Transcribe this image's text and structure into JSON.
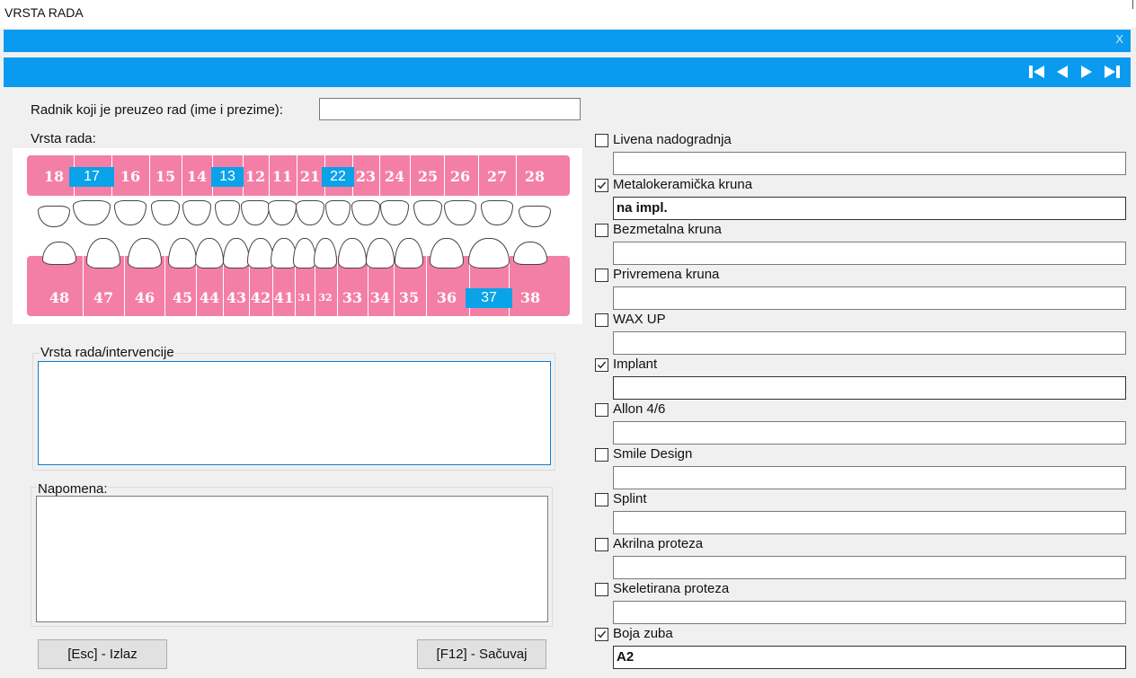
{
  "window": {
    "title": "VRSTA RADA",
    "close_label": "X"
  },
  "nav": [
    {
      "name": "first-record-icon"
    },
    {
      "name": "previous-record-icon"
    },
    {
      "name": "next-record-icon"
    },
    {
      "name": "last-record-icon"
    }
  ],
  "worker": {
    "label": "Radnik koji je preuzeo rad (ime i prezime):",
    "value": ""
  },
  "chart": {
    "label": "Vrsta rada:",
    "upper": [
      "18",
      "17",
      "16",
      "15",
      "14",
      "13",
      "12",
      "11",
      "21",
      "22",
      "23",
      "24",
      "25",
      "26",
      "27",
      "28"
    ],
    "lower": [
      "48",
      "47",
      "46",
      "45",
      "44",
      "43",
      "42",
      "41",
      "31",
      "32",
      "33",
      "34",
      "35",
      "36",
      "37",
      "38"
    ],
    "selected": [
      "17",
      "13",
      "22",
      "37"
    ],
    "band_color": "#f47fa6",
    "selected_color": "#0aa2e8"
  },
  "intervention": {
    "label": "Vrsta rada/intervencije",
    "value": ""
  },
  "note": {
    "label": "Napomena:",
    "value": ""
  },
  "buttons": {
    "exit": "[Esc] - Izlaz",
    "save": "[F12] - Sačuvaj"
  },
  "options": [
    {
      "label": "Livena nadogradnja",
      "checked": false,
      "value": ""
    },
    {
      "label": "Metalokeramička kruna",
      "checked": true,
      "value": "na impl."
    },
    {
      "label": "Bezmetalna kruna",
      "checked": false,
      "value": ""
    },
    {
      "label": "Privremena kruna",
      "checked": false,
      "value": ""
    },
    {
      "label": "WAX UP",
      "checked": false,
      "value": ""
    },
    {
      "label": "Implant",
      "checked": true,
      "value": ""
    },
    {
      "label": "Allon 4/6",
      "checked": false,
      "value": ""
    },
    {
      "label": "Smile Design",
      "checked": false,
      "value": ""
    },
    {
      "label": "Splint",
      "checked": false,
      "value": ""
    },
    {
      "label": "Akrilna proteza",
      "checked": false,
      "value": ""
    },
    {
      "label": "Skeletirana proteza",
      "checked": false,
      "value": ""
    },
    {
      "label": "Boja zuba",
      "checked": true,
      "value": "A2"
    }
  ],
  "accent_color": "#0a9bf0"
}
